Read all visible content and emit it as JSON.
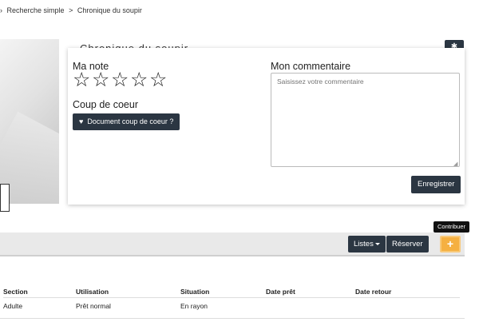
{
  "breadcrumb": {
    "arrow": "›",
    "item1": "Recherche simple",
    "sep": ">",
    "item2": "Chronique du soupir"
  },
  "title_peek": "Chronique du soupir",
  "rating": {
    "label": "Ma note",
    "stars": [
      "☆",
      "☆",
      "☆",
      "☆",
      "☆"
    ],
    "value": 0,
    "max": 5
  },
  "favorite": {
    "label": "Coup de coeur",
    "heart": "♥",
    "button": "Document coup de coeur ?"
  },
  "comment": {
    "label": "Mon commentaire",
    "placeholder": "Saisissez votre commentaire",
    "save": "Enregistrer"
  },
  "toolbar": {
    "lists": "Listes",
    "reserve": "Réserver",
    "contribute_tooltip": "Contribuer",
    "plus": "+",
    "gear": "✱"
  },
  "table": {
    "headers": [
      "Section",
      "Utilisation",
      "Situation",
      "Date prêt",
      "Date retour"
    ],
    "rows": [
      [
        "Adulte",
        "Prêt normal",
        "En rayon",
        "",
        ""
      ]
    ]
  },
  "colors": {
    "dark_button": "#2b3642",
    "accent_orange": "#f5b041",
    "toolbar_bg": "#e9e9e9"
  }
}
